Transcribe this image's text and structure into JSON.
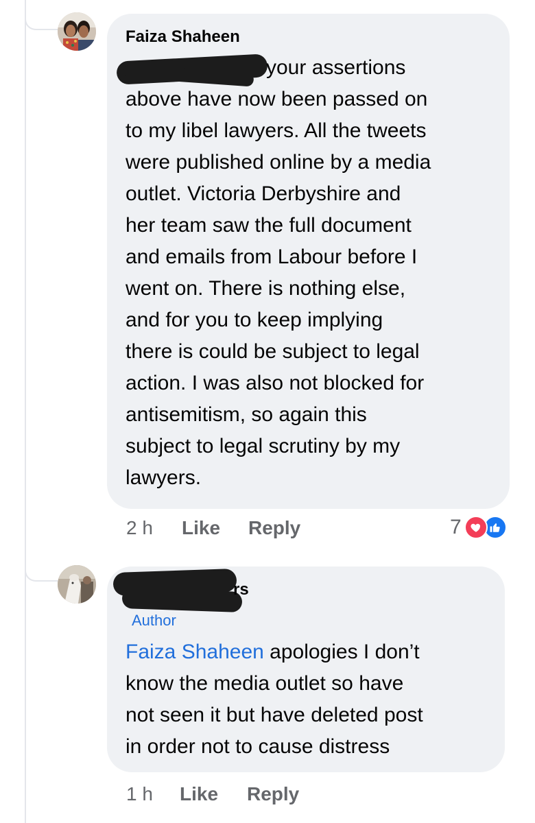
{
  "comments": [
    {
      "author": "Faiza Shaheen",
      "text_lines": [
        "your assertions",
        "above have now been passed on",
        "to my libel lawyers. All the tweets",
        "were published online by a media",
        "outlet. Victoria Derbyshire and",
        "her team saw the full document",
        "and emails from Labour before I",
        "went on. There is nothing else,",
        "and for you to keep implying",
        "there is could be subject to legal",
        "action. I was also not blocked for",
        "antisemitism, so again this",
        "subject to legal scrutiny by my",
        "lawyers."
      ],
      "time": "2 h",
      "like_label": "Like",
      "reply_label": "Reply",
      "reaction_count": "7",
      "reactions": [
        "heart-icon",
        "thumbs-up-icon"
      ]
    },
    {
      "author_partial": "rs",
      "author_badge": "Author",
      "mention": "Faiza Shaheen",
      "text_first_rest": " apologies  I don’t",
      "text_lines": [
        "know the media outlet so have",
        "not seen it but have deleted post",
        "in order not to cause distress"
      ],
      "time": "1 h",
      "like_label": "Like",
      "reply_label": "Reply"
    }
  ],
  "colors": {
    "bubble": "#eff1f4",
    "link": "#216fdb",
    "meta": "#65676b",
    "heart": "#f33e58",
    "like": "#1877f2"
  }
}
